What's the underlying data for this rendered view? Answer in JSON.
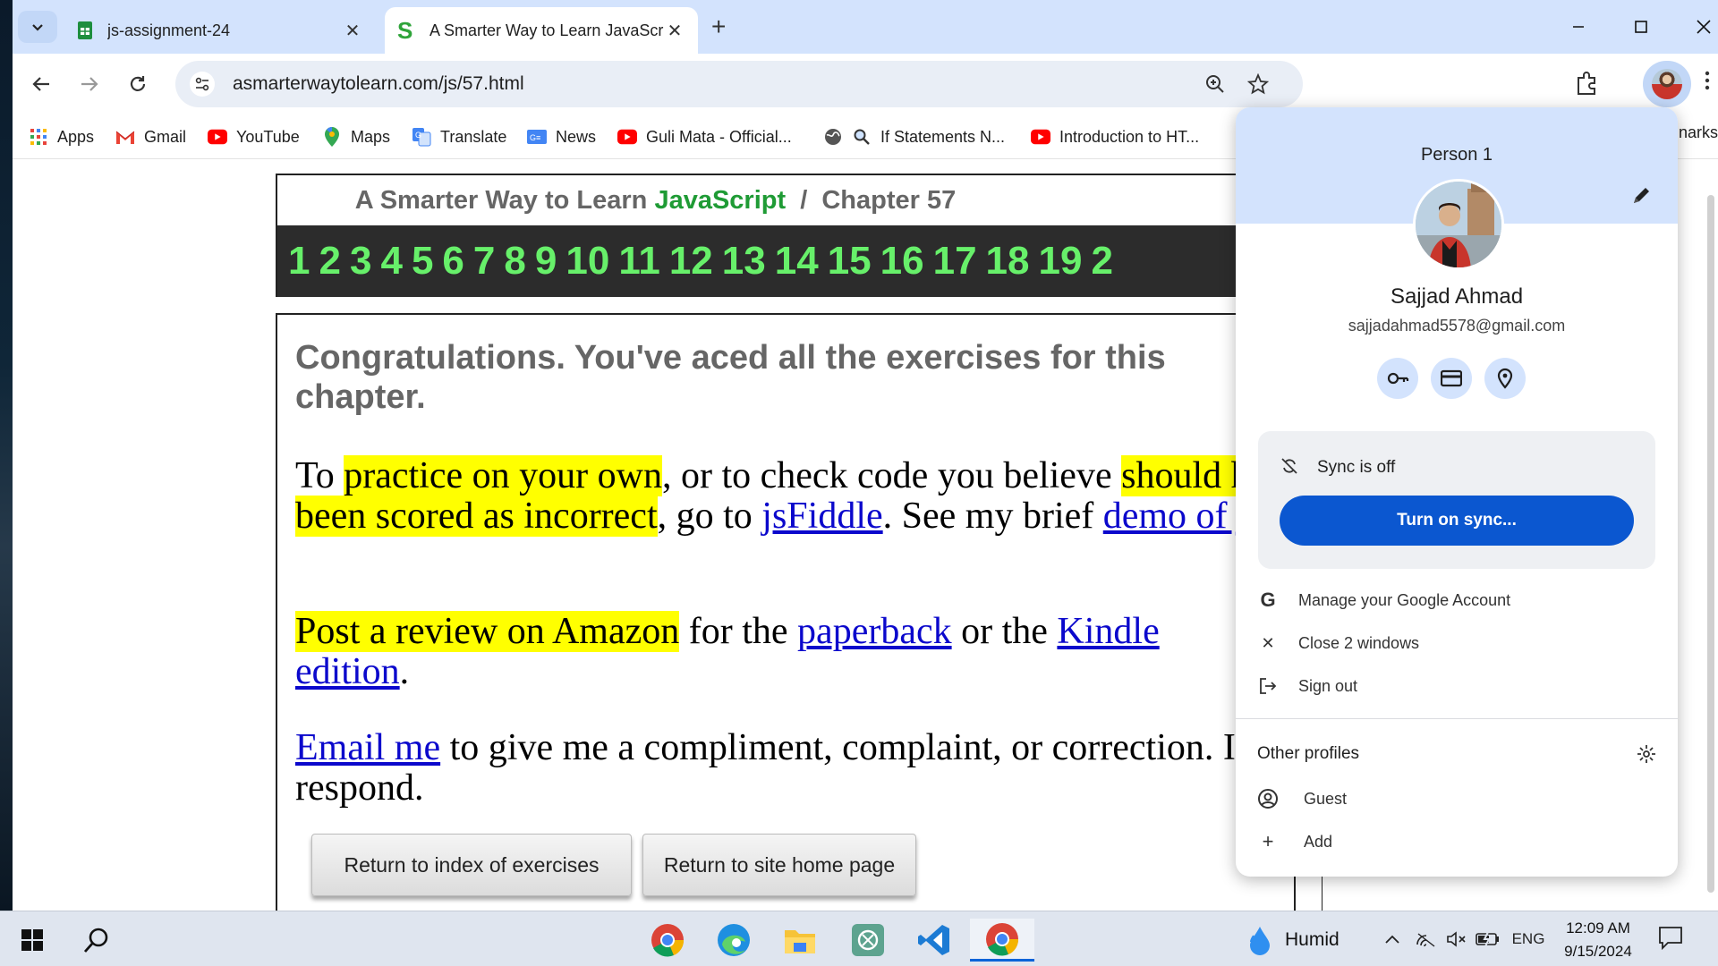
{
  "browser": {
    "tabs": [
      {
        "title": "js-assignment-24",
        "icon": "google-sheets-icon"
      },
      {
        "title": "A Smarter Way to Learn JavaScri",
        "icon": "site-s-icon",
        "active": true
      }
    ],
    "url": "asmarterwaytolearn.com/js/57.html"
  },
  "bookmarks": [
    {
      "label": "Apps",
      "icon": "apps-grid-icon"
    },
    {
      "label": "Gmail",
      "icon": "gmail-icon"
    },
    {
      "label": "YouTube",
      "icon": "youtube-icon"
    },
    {
      "label": "Maps",
      "icon": "maps-pin-icon"
    },
    {
      "label": "Translate",
      "icon": "translate-icon"
    },
    {
      "label": "News",
      "icon": "news-icon"
    },
    {
      "label": "Guli Mata - Official...",
      "icon": "youtube-icon"
    },
    {
      "label": "If Statements N...",
      "icon": "search-globe-icon"
    },
    {
      "label": "Introduction to HT...",
      "icon": "youtube-icon"
    }
  ],
  "bookmarks_overflow": "narks",
  "page": {
    "title_prefix": "A Smarter Way to Learn",
    "title_js": "JavaScript",
    "title_sep": "/",
    "title_chapter": "Chapter 57",
    "chapter_numbers": [
      "1",
      "2",
      "3",
      "4",
      "5",
      "6",
      "7",
      "8",
      "9",
      "10",
      "11",
      "12",
      "13",
      "14",
      "15",
      "16",
      "17",
      "18",
      "19",
      "2"
    ],
    "congrats": "Congratulations. You've aced all the exercises for this chapter.",
    "p1": {
      "t1": "To ",
      "h1": "practice on your own",
      "t2": ", or to check code you believe ",
      "h2": "should have been scored as incorrect",
      "t3": ", go to ",
      "l1": "jsFiddle",
      "t4": ". See my brief ",
      "l2": "demo of jsFiddle",
      "t5": "."
    },
    "p2": {
      "h1": "Post a review on Amazon",
      "t1": " for the ",
      "l1": "paperback",
      "t2": " or the ",
      "l2": "Kindle edition",
      "t3": "."
    },
    "p3": {
      "l1": "Email me",
      "t1": " to give me a compliment, complaint, or correction. I'll respond."
    },
    "buttons": {
      "index": "Return to index of exercises",
      "home": "Return to site home page"
    }
  },
  "profile_menu": {
    "person_label": "Person 1",
    "name": "Sajjad Ahmad",
    "email": "sajjadahmad5578@gmail.com",
    "sync_status": "Sync is off",
    "sync_button": "Turn on sync...",
    "items": {
      "manage": "Manage your Google Account",
      "close": "Close 2 windows",
      "signout": "Sign out"
    },
    "other_profiles": "Other profiles",
    "guest": "Guest",
    "add": "Add"
  },
  "taskbar": {
    "weather": "Humid",
    "language": "ENG",
    "time": "12:09 AM",
    "date": "9/15/2024"
  },
  "colors": {
    "accent": "#0b57d0",
    "chrome_tabstrip": "#d3e3fd",
    "js_green": "#1f9b35",
    "number_green": "#67f06a",
    "highlight": "#ffff00",
    "link": "#0b08cc"
  }
}
